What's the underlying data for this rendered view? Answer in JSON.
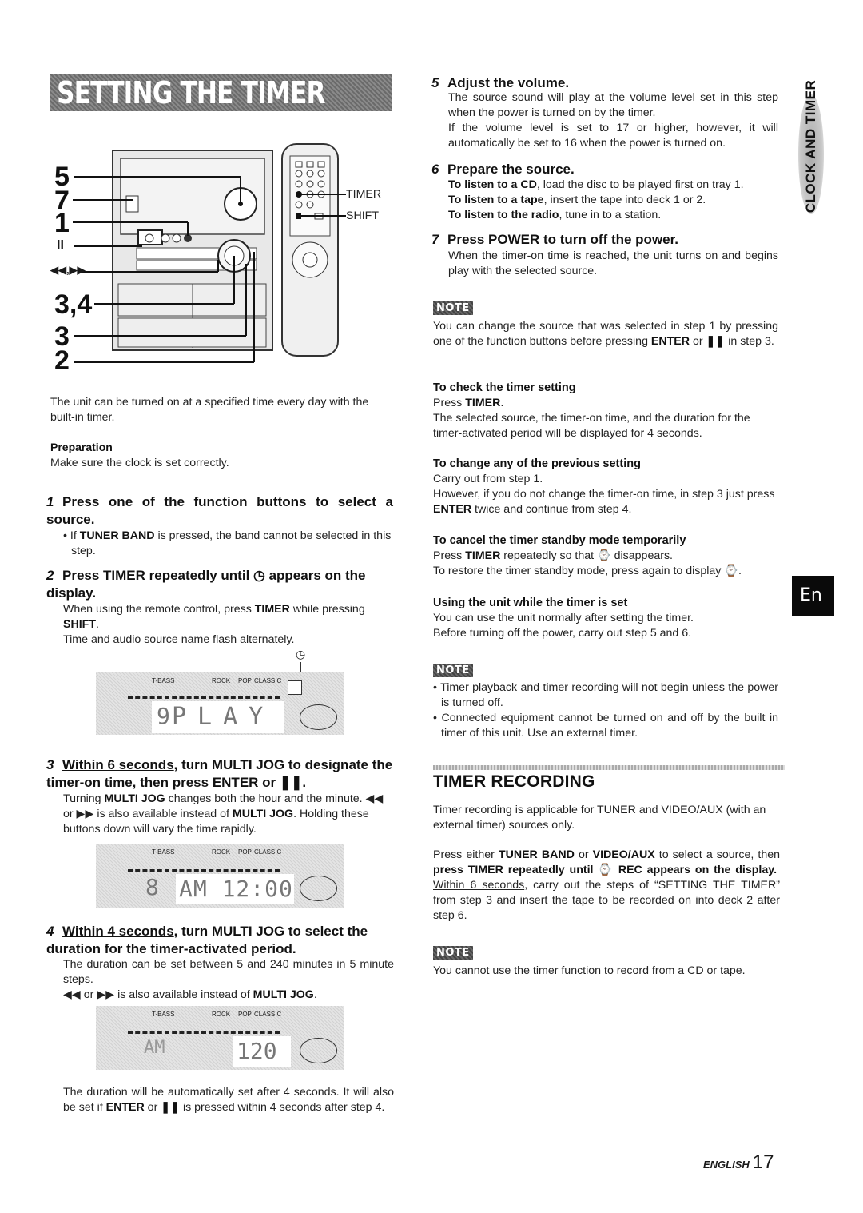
{
  "page": {
    "title": "SETTING THE TIMER",
    "side_tab": "CLOCK AND TIMER",
    "language_tab": "En",
    "footer_language": "ENGLISH",
    "page_number": "17"
  },
  "illustration": {
    "callouts": [
      "5",
      "7",
      "1",
      "II",
      "◀◀,▶▶",
      "3,4",
      "3",
      "2"
    ],
    "remote_labels": [
      "TIMER",
      "SHIFT"
    ]
  },
  "intro": {
    "text": "The unit can be turned on at a specified time every day with the built-in timer.",
    "preparation_title": "Preparation",
    "preparation_text": "Make sure the clock is set correctly."
  },
  "steps": [
    {
      "num": "1",
      "title": "Press one of the function buttons to select a source.",
      "bullet_bold": "TUNER BAND",
      "bullet_pre": "If ",
      "bullet_post": " is pressed, the band cannot be selected in this step."
    },
    {
      "num": "2",
      "title_pre": "Press TIMER repeatedly until ",
      "title_post": " appears on the display.",
      "p1_pre": "When using the remote control, press ",
      "p1_b1": "TIMER",
      "p1_mid": " while pressing ",
      "p1_b2": "SHIFT",
      "p1_post": ".",
      "p2": "Time and audio source name flash alternately."
    },
    {
      "num": "3",
      "title_u": "Within 6 seconds",
      "title_rest": ", turn MULTI JOG to designate the timer-on time, then press ENTER or ❚❚.",
      "p_pre": "Turning ",
      "p_b1": "MULTI JOG",
      "p_mid1": " changes both the hour and the minute. ◀◀ or ▶▶ is also available instead of ",
      "p_b2": "MULTI JOG",
      "p_post": ". Holding these buttons down will vary the time rapidly."
    },
    {
      "num": "4",
      "title_u": "Within 4 seconds",
      "title_rest": ", turn MULTI JOG to select the duration for the timer-activated period.",
      "p1": "The duration can be set between 5 and 240 minutes in 5 minute steps.",
      "p2_pre": "◀◀ or ▶▶ is also available instead of ",
      "p2_b": "MULTI JOG",
      "p2_post": ".",
      "after_pre": "The duration will be automatically set after 4 seconds. It will also be set if ",
      "after_b1": "ENTER",
      "after_mid": " or ",
      "after_b2": "❚❚",
      "after_post": " is pressed within 4 seconds after step 4."
    },
    {
      "num": "5",
      "title": "Adjust the volume.",
      "p1": "The source sound will play at the volume level set in this step when the power is turned on by the timer.",
      "p2": "If the volume level is set to 17 or higher, however, it will automatically be set to 16 when the power is turned on."
    },
    {
      "num": "6",
      "title": "Prepare the source.",
      "lines": [
        {
          "b": "To listen to a CD",
          "t": ", load the disc to be played first on tray 1."
        },
        {
          "b": "To listen to a tape",
          "t": ", insert the tape into deck 1 or 2."
        },
        {
          "b": "To listen to the radio",
          "t": ", tune in to a station."
        }
      ]
    },
    {
      "num": "7",
      "title": "Press POWER to turn off the power.",
      "p1": "When the timer-on time is reached, the unit turns on and begins play with the selected source."
    }
  ],
  "displays": [
    {
      "labels": [
        "T-BASS",
        "ROCK",
        "POP",
        "CLASSIC"
      ],
      "main": "PLAY",
      "left": "9"
    },
    {
      "labels": [
        "T-BASS",
        "ROCK",
        "POP",
        "CLASSIC"
      ],
      "main": "AM 12:00",
      "left": "8"
    },
    {
      "labels": [
        "T-BASS",
        "ROCK",
        "POP",
        "CLASSIC"
      ],
      "main": "120",
      "left": "AM"
    }
  ],
  "note1": {
    "label": "NOTE",
    "pre": "You can change the source that was selected in step 1 by pressing one of the function buttons before pressing ",
    "b": "ENTER",
    "mid": " or ",
    "b2": "❚❚",
    "post": " in step 3."
  },
  "check": {
    "title": "To check the timer setting",
    "l1_pre": "Press ",
    "l1_b": "TIMER",
    "l1_post": ".",
    "l2": "The selected source, the timer-on time, and the duration for the timer-activated period will be displayed for 4 seconds."
  },
  "change": {
    "title": "To change any of the previous setting",
    "l1": "Carry out from step 1.",
    "l2_pre": "However, if you do not change the timer-on time, in step 3 just press ",
    "l2_b": "ENTER",
    "l2_post": " twice and continue from step 4."
  },
  "cancel": {
    "title": "To cancel the timer standby mode temporarily",
    "l1_pre": "Press ",
    "l1_b": "TIMER",
    "l1_post": " repeatedly so that ⌚ disappears.",
    "l2": "To restore the timer standby mode, press again to display ⌚."
  },
  "using": {
    "title": "Using the unit while the timer is set",
    "l1": "You can use the unit normally after setting the timer.",
    "l2": "Before turning off the power, carry out step 5 and 6."
  },
  "note2": {
    "label": "NOTE",
    "bullets": [
      "Timer playback and timer recording will not begin unless the power is turned off.",
      "Connected equipment cannot be turned on and off by the built in timer of this unit.  Use an external timer."
    ]
  },
  "timer_recording": {
    "title": "TIMER RECORDING",
    "p1": "Timer recording is applicable for TUNER and VIDEO/AUX (with an external timer) sources only.",
    "p2_pre": "Press either ",
    "p2_b1": "TUNER BAND",
    "p2_or": " or ",
    "p2_b2": "VIDEO/AUX",
    "p2_mid": " to select a source, then ",
    "p2_b3": "press TIMER repeatedly until ⌚ REC appears on the display.",
    "p2_u": "Within 6 seconds",
    "p2_post": ", carry out the steps of “SETTING THE TIMER” from step 3 and insert the tape to be recorded on into deck 2 after step 6.",
    "note_label": "NOTE",
    "note_text": "You cannot use the timer function to record from a CD or tape."
  }
}
